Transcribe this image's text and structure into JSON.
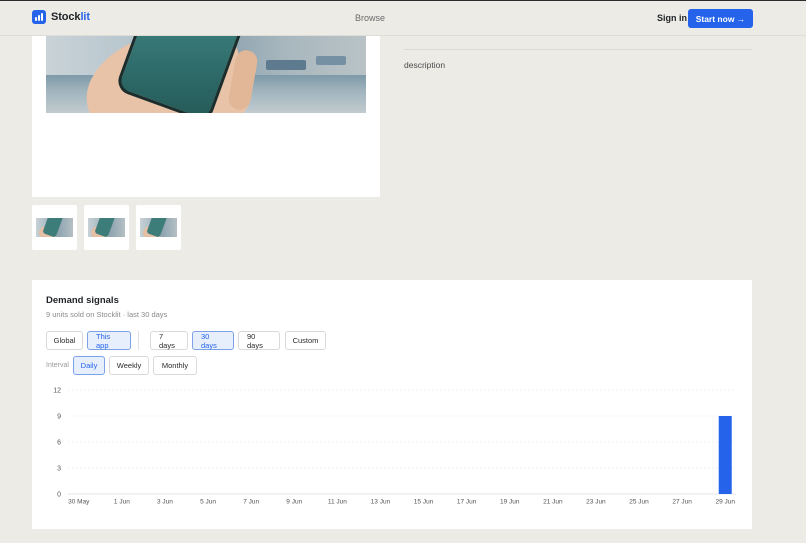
{
  "header": {
    "brand_main": "Stock",
    "brand_accent": "lit",
    "browse": "Browse",
    "sign_in": "Sign in",
    "start_now": "Start now →"
  },
  "listing": {
    "description": "description",
    "thumbnail_count": 3
  },
  "demand": {
    "title": "Demand signals",
    "subtitle": "9 units sold on Stocklit · last 30 days",
    "scope_buttons": [
      {
        "label": "Global",
        "active": false
      },
      {
        "label": "This app",
        "active": true
      }
    ],
    "range_buttons": [
      {
        "label": "7 days",
        "active": false
      },
      {
        "label": "30 days",
        "active": true
      },
      {
        "label": "90 days",
        "active": false
      },
      {
        "label": "Custom",
        "active": false
      }
    ],
    "interval_label": "Interval",
    "interval_buttons": [
      {
        "label": "Daily",
        "active": true
      },
      {
        "label": "Weekly",
        "active": false
      },
      {
        "label": "Monthly",
        "active": false
      }
    ]
  },
  "colors": {
    "accent": "#2563eb",
    "background": "#ecebe6",
    "card": "#ffffff"
  },
  "chart_data": {
    "type": "bar",
    "x_tick_labels": [
      "30 May",
      "1 Jun",
      "3 Jun",
      "5 Jun",
      "7 Jun",
      "9 Jun",
      "11 Jun",
      "13 Jun",
      "15 Jun",
      "17 Jun",
      "19 Jun",
      "21 Jun",
      "23 Jun",
      "25 Jun",
      "27 Jun",
      "29 Jun"
    ],
    "categories": [
      "30 May",
      "31 May",
      "1 Jun",
      "2 Jun",
      "3 Jun",
      "4 Jun",
      "5 Jun",
      "6 Jun",
      "7 Jun",
      "8 Jun",
      "9 Jun",
      "10 Jun",
      "11 Jun",
      "12 Jun",
      "13 Jun",
      "14 Jun",
      "15 Jun",
      "16 Jun",
      "17 Jun",
      "18 Jun",
      "19 Jun",
      "20 Jun",
      "21 Jun",
      "22 Jun",
      "23 Jun",
      "24 Jun",
      "25 Jun",
      "26 Jun",
      "27 Jun",
      "28 Jun",
      "29 Jun"
    ],
    "values": [
      0,
      0,
      0,
      0,
      0,
      0,
      0,
      0,
      0,
      0,
      0,
      0,
      0,
      0,
      0,
      0,
      0,
      0,
      0,
      0,
      0,
      0,
      0,
      0,
      0,
      0,
      0,
      0,
      0,
      0,
      9
    ],
    "y_ticks": [
      0,
      3,
      6,
      9,
      12
    ],
    "ylim": [
      0,
      12
    ],
    "grid": true,
    "bar_color": "#2563eb"
  }
}
